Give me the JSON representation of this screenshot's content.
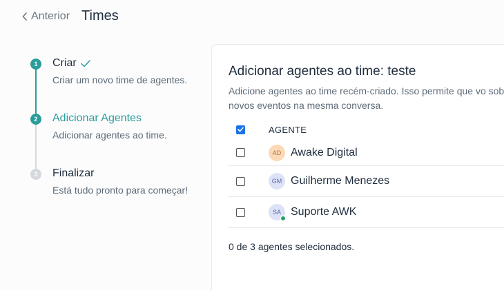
{
  "header": {
    "back_label": "Anterior",
    "title": "Times"
  },
  "steps": [
    {
      "number": "1",
      "title": "Criar",
      "description": "Criar um novo time de agentes.",
      "state": "done"
    },
    {
      "number": "2",
      "title": "Adicionar Agentes",
      "description": "Adicionar agentes ao time.",
      "state": "active"
    },
    {
      "number": "3",
      "title": "Finalizar",
      "description": "Está tudo pronto para começar!",
      "state": "pending"
    }
  ],
  "panel": {
    "title": "Adicionar agentes ao time: teste",
    "description": "Adicione agentes ao time recém-criado. Isso permite que vo sobre novos eventos na mesma conversa.",
    "table_header": "AGENTE",
    "select_all_checked": true,
    "agents": [
      {
        "initials": "AD",
        "name": "Awake Digital",
        "avatar_bg": "#fbd9b6",
        "avatar_fg": "#b5733a",
        "online": false,
        "checked": false
      },
      {
        "initials": "GM",
        "name": "Guilherme Menezes",
        "avatar_bg": "#dde3f7",
        "avatar_fg": "#5b6aa8",
        "online": false,
        "checked": false
      },
      {
        "initials": "SA",
        "name": "Suporte AWK",
        "avatar_bg": "#dde3f7",
        "avatar_fg": "#5b6aa8",
        "online": true,
        "checked": false
      }
    ],
    "summary": "0 de 3 agentes selecionados."
  },
  "colors": {
    "accent": "#2a9d9b",
    "checkbox": "#1a73e8",
    "online": "#29a36a"
  }
}
